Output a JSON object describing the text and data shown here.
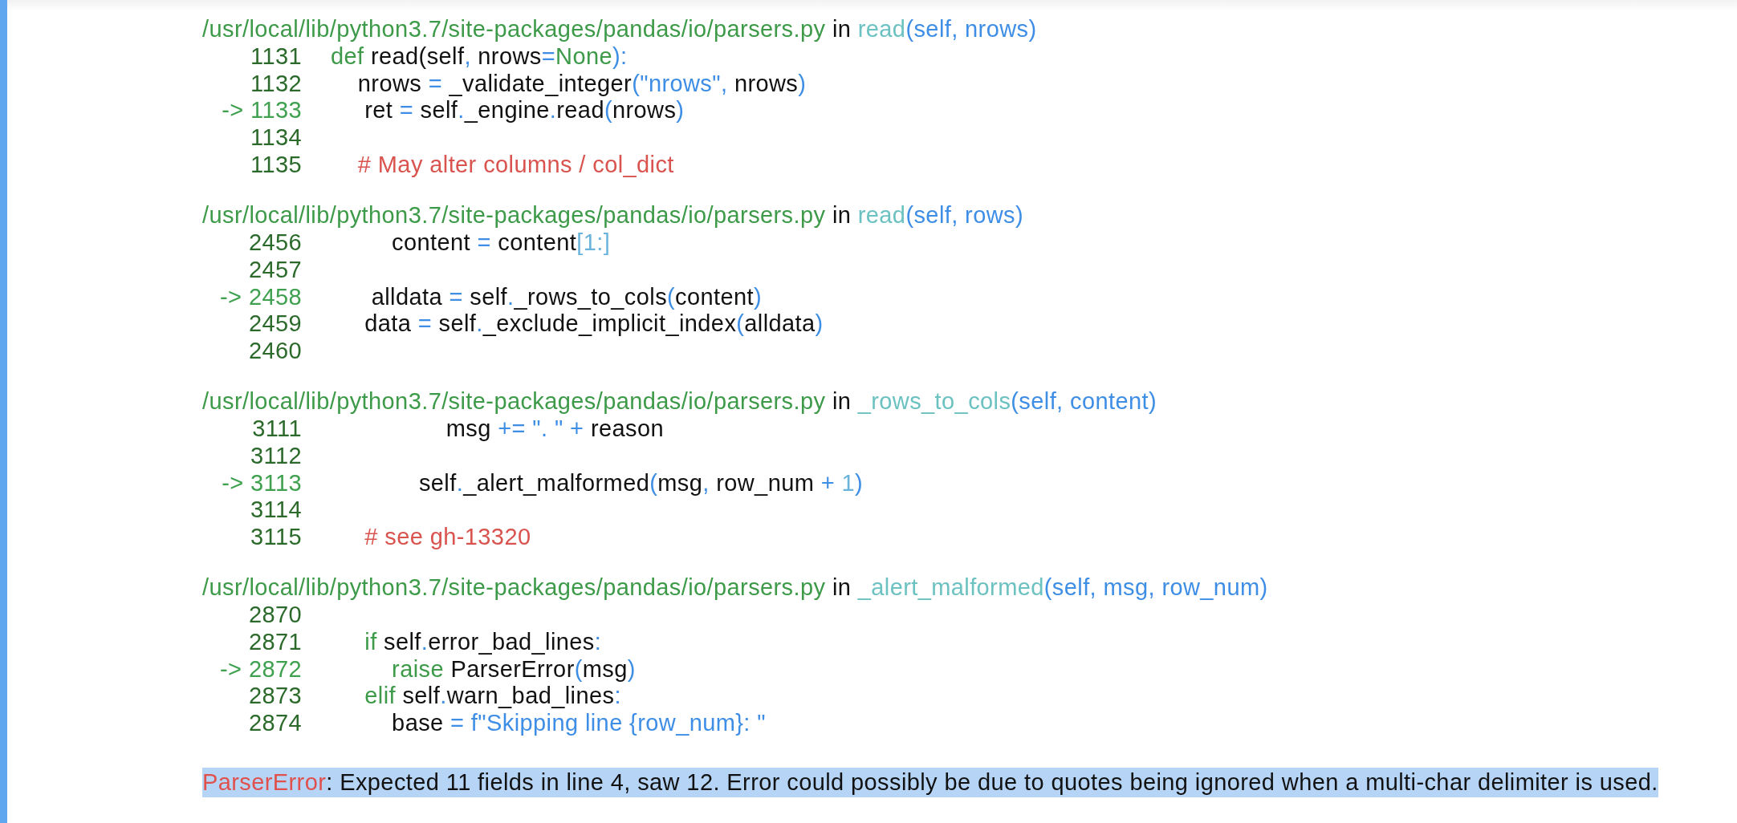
{
  "frames": [
    {
      "path": "/usr/local/lib/python3.7/site-packages/pandas/io/parsers.py",
      "in": "in",
      "func": "read",
      "args": "(self, nrows)",
      "lines": [
        {
          "num": "1131",
          "current": false,
          "tokens": [
            {
              "kind": "kw",
              "text": "def"
            },
            {
              "kind": "text",
              "text": " read(self"
            },
            {
              "kind": "op",
              "text": ","
            },
            {
              "kind": "text",
              "text": " nrows"
            },
            {
              "kind": "op",
              "text": "="
            },
            {
              "kind": "kw",
              "text": "None"
            },
            {
              "kind": "op",
              "text": "):"
            }
          ]
        },
        {
          "num": "1132",
          "current": false,
          "tokens": [
            {
              "kind": "text",
              "text": "    nrows "
            },
            {
              "kind": "op",
              "text": "="
            },
            {
              "kind": "text",
              "text": " _validate_integer"
            },
            {
              "kind": "op",
              "text": "(\"nrows\","
            },
            {
              "kind": "text",
              "text": " nrows"
            },
            {
              "kind": "op",
              "text": ")"
            }
          ]
        },
        {
          "num": "-> 1133",
          "current": true,
          "tokens": [
            {
              "kind": "text",
              "text": "     ret "
            },
            {
              "kind": "op",
              "text": "="
            },
            {
              "kind": "text",
              "text": " self"
            },
            {
              "kind": "op",
              "text": "."
            },
            {
              "kind": "text",
              "text": "_engine"
            },
            {
              "kind": "op",
              "text": "."
            },
            {
              "kind": "text",
              "text": "read"
            },
            {
              "kind": "op",
              "text": "("
            },
            {
              "kind": "text",
              "text": "nrows"
            },
            {
              "kind": "op",
              "text": ")"
            }
          ]
        },
        {
          "num": "1134",
          "current": false
        },
        {
          "num": "1135",
          "current": false,
          "tokens": [
            {
              "kind": "comment",
              "text": "    # May alter columns / col_dict"
            }
          ]
        }
      ]
    },
    {
      "path": "/usr/local/lib/python3.7/site-packages/pandas/io/parsers.py",
      "in": "in",
      "func": "read",
      "args": "(self, rows)",
      "lines": [
        {
          "num": "2456",
          "current": false,
          "tokens": [
            {
              "kind": "text",
              "text": "         content "
            },
            {
              "kind": "op",
              "text": "="
            },
            {
              "kind": "text",
              "text": " content"
            },
            {
              "kind": "num",
              "text": "[1:]"
            }
          ]
        },
        {
          "num": "2457",
          "current": false
        },
        {
          "num": "-> 2458",
          "current": true,
          "tokens": [
            {
              "kind": "text",
              "text": "      alldata "
            },
            {
              "kind": "op",
              "text": "="
            },
            {
              "kind": "text",
              "text": " self"
            },
            {
              "kind": "op",
              "text": "."
            },
            {
              "kind": "text",
              "text": "_rows_to_cols"
            },
            {
              "kind": "op",
              "text": "("
            },
            {
              "kind": "text",
              "text": "content"
            },
            {
              "kind": "op",
              "text": ")"
            }
          ]
        },
        {
          "num": "2459",
          "current": false,
          "tokens": [
            {
              "kind": "text",
              "text": "     data "
            },
            {
              "kind": "op",
              "text": "="
            },
            {
              "kind": "text",
              "text": " self"
            },
            {
              "kind": "op",
              "text": "."
            },
            {
              "kind": "text",
              "text": "_exclude_implicit_index"
            },
            {
              "kind": "op",
              "text": "("
            },
            {
              "kind": "text",
              "text": "alldata"
            },
            {
              "kind": "op",
              "text": ")"
            }
          ]
        },
        {
          "num": "2460",
          "current": false
        }
      ]
    },
    {
      "path": "/usr/local/lib/python3.7/site-packages/pandas/io/parsers.py",
      "in": "in",
      "func": "_rows_to_cols",
      "args": "(self, content)",
      "lines": [
        {
          "num": "3111",
          "current": false,
          "tokens": [
            {
              "kind": "text",
              "text": "                 msg "
            },
            {
              "kind": "op",
              "text": "+= \". \" +"
            },
            {
              "kind": "text",
              "text": " reason"
            }
          ]
        },
        {
          "num": "3112",
          "current": false
        },
        {
          "num": "-> 3113",
          "current": true,
          "tokens": [
            {
              "kind": "text",
              "text": "             self"
            },
            {
              "kind": "op",
              "text": "."
            },
            {
              "kind": "text",
              "text": "_alert_malformed"
            },
            {
              "kind": "op",
              "text": "("
            },
            {
              "kind": "text",
              "text": "msg"
            },
            {
              "kind": "op",
              "text": ","
            },
            {
              "kind": "text",
              "text": " row_num "
            },
            {
              "kind": "op",
              "text": "+"
            },
            {
              "kind": "num",
              "text": " 1"
            },
            {
              "kind": "op",
              "text": ")"
            }
          ]
        },
        {
          "num": "3114",
          "current": false
        },
        {
          "num": "3115",
          "current": false,
          "tokens": [
            {
              "kind": "comment",
              "text": "     # see gh-13320"
            }
          ]
        }
      ]
    },
    {
      "path": "/usr/local/lib/python3.7/site-packages/pandas/io/parsers.py",
      "in": "in",
      "func": "_alert_malformed",
      "args": "(self, msg, row_num)",
      "lines": [
        {
          "num": "2870",
          "current": false
        },
        {
          "num": "2871",
          "current": false,
          "tokens": [
            {
              "kind": "kw",
              "text": "     if"
            },
            {
              "kind": "text",
              "text": " self"
            },
            {
              "kind": "op",
              "text": "."
            },
            {
              "kind": "text",
              "text": "error_bad_lines"
            },
            {
              "kind": "op",
              "text": ":"
            }
          ]
        },
        {
          "num": "-> 2872",
          "current": true,
          "tokens": [
            {
              "kind": "kw",
              "text": "         raise"
            },
            {
              "kind": "text",
              "text": " ParserError"
            },
            {
              "kind": "op",
              "text": "("
            },
            {
              "kind": "text",
              "text": "msg"
            },
            {
              "kind": "op",
              "text": ")"
            }
          ]
        },
        {
          "num": "2873",
          "current": false,
          "tokens": [
            {
              "kind": "kw",
              "text": "     elif"
            },
            {
              "kind": "text",
              "text": " self"
            },
            {
              "kind": "op",
              "text": "."
            },
            {
              "kind": "text",
              "text": "warn_bad_lines"
            },
            {
              "kind": "op",
              "text": ":"
            }
          ]
        },
        {
          "num": "2874",
          "current": false,
          "tokens": [
            {
              "kind": "text",
              "text": "         base "
            },
            {
              "kind": "op",
              "text": "="
            },
            {
              "kind": "str",
              "text": " f\"Skipping line {row_num}: \""
            }
          ]
        }
      ]
    }
  ],
  "error": {
    "name": "ParserError",
    "message": ": Expected 11 fields in line 4, saw 12. Error could possibly be due to quotes being ignored when a multi-char delimiter is used."
  }
}
